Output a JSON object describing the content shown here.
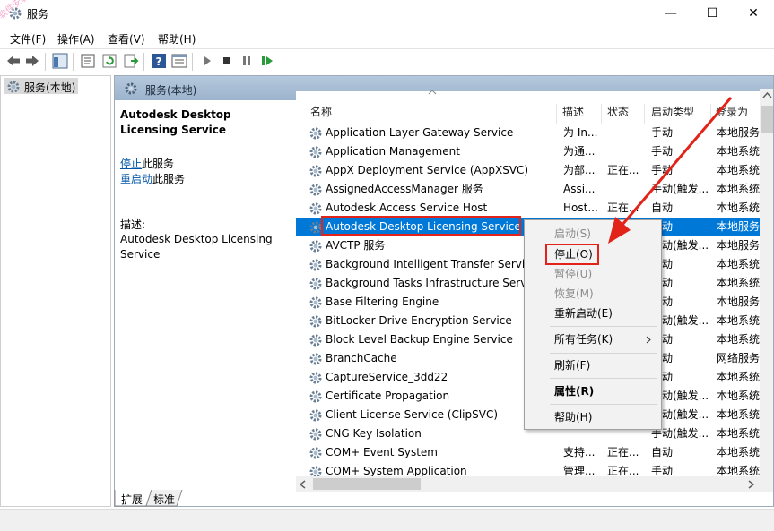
{
  "window": {
    "title": "服务",
    "icon": "gear-icon",
    "minimize_glyph": "—",
    "maximize_glyph": "☐",
    "close_glyph": "✕"
  },
  "menu": [
    "文件(F)",
    "操作(A)",
    "查看(V)",
    "帮助(H)"
  ],
  "tree": {
    "root_label": "服务(本地)"
  },
  "panel": {
    "header_title": "服务(本地)"
  },
  "description": {
    "service_title": "Autodesk Desktop Licensing Service",
    "stop_link": "停止",
    "stop_suffix": "此服务",
    "restart_link": "重启动",
    "restart_suffix": "此服务",
    "desc_label": "描述:",
    "desc_text": "Autodesk Desktop Licensing Service"
  },
  "columns": {
    "name": "名称",
    "desc": "描述",
    "status": "状态",
    "startup": "启动类型",
    "logon": "登录为"
  },
  "services": [
    {
      "name": "Application Layer Gateway Service",
      "desc": "为 In...",
      "status": "",
      "startup": "手动",
      "logon": "本地服务"
    },
    {
      "name": "Application Management",
      "desc": "为通...",
      "status": "",
      "startup": "手动",
      "logon": "本地系统"
    },
    {
      "name": "AppX Deployment Service (AppXSVC)",
      "desc": "为部...",
      "status": "正在...",
      "startup": "手动",
      "logon": "本地系统"
    },
    {
      "name": "AssignedAccessManager 服务",
      "desc": "Assi...",
      "status": "",
      "startup": "手动(触发...",
      "logon": "本地系统"
    },
    {
      "name": "Autodesk Access Service Host",
      "desc": "Host...",
      "status": "正在...",
      "startup": "自动",
      "logon": "本地系统"
    },
    {
      "name": "Autodesk Desktop Licensing Service",
      "desc": "",
      "status": "",
      "startup": "自动",
      "logon": "本地服务"
    },
    {
      "name": "AVCTP 服务",
      "desc": "",
      "status": "",
      "startup": "手动(触发...",
      "logon": "本地服务"
    },
    {
      "name": "Background Intelligent Transfer Service",
      "desc": "",
      "status": "",
      "startup": "自动",
      "logon": "本地系统"
    },
    {
      "name": "Background Tasks Infrastructure Service",
      "desc": "",
      "status": "",
      "startup": "自动",
      "logon": "本地系统"
    },
    {
      "name": "Base Filtering Engine",
      "desc": "",
      "status": "",
      "startup": "自动",
      "logon": "本地服务"
    },
    {
      "name": "BitLocker Drive Encryption Service",
      "desc": "",
      "status": "",
      "startup": "手动(触发...",
      "logon": "本地系统"
    },
    {
      "name": "Block Level Backup Engine Service",
      "desc": "",
      "status": "",
      "startup": "手动",
      "logon": "本地系统"
    },
    {
      "name": "BranchCache",
      "desc": "",
      "status": "",
      "startup": "手动",
      "logon": "网络服务"
    },
    {
      "name": "CaptureService_3dd22",
      "desc": "",
      "status": "",
      "startup": "手动",
      "logon": "本地系统"
    },
    {
      "name": "Certificate Propagation",
      "desc": "",
      "status": "",
      "startup": "手动(触发...",
      "logon": "本地系统"
    },
    {
      "name": "Client License Service (ClipSVC)",
      "desc": "",
      "status": "",
      "startup": "手动(触发...",
      "logon": "本地系统"
    },
    {
      "name": "CNG Key Isolation",
      "desc": "",
      "status": "",
      "startup": "手动(触发...",
      "logon": "本地系统"
    },
    {
      "name": "COM+ Event System",
      "desc": "支持...",
      "status": "正在...",
      "startup": "自动",
      "logon": "本地系统"
    },
    {
      "name": "COM+ System Application",
      "desc": "管理...",
      "status": "正在...",
      "startup": "手动",
      "logon": "本地系统"
    }
  ],
  "selected_index": 5,
  "context_menu": {
    "start": "启动(S)",
    "stop": "停止(O)",
    "pause": "暂停(U)",
    "resume": "恢复(M)",
    "restart": "重新启动(E)",
    "all_tasks": "所有任务(K)",
    "refresh": "刷新(F)",
    "properties": "属性(R)",
    "help": "帮助(H)"
  },
  "tabs": [
    "扩展",
    "标准"
  ],
  "watermark": "软件安装管家",
  "colors": {
    "selection": "#0078d7",
    "annotation_red": "#e2231a",
    "link": "#0054a6",
    "panel_header": "#a9bfd6"
  }
}
